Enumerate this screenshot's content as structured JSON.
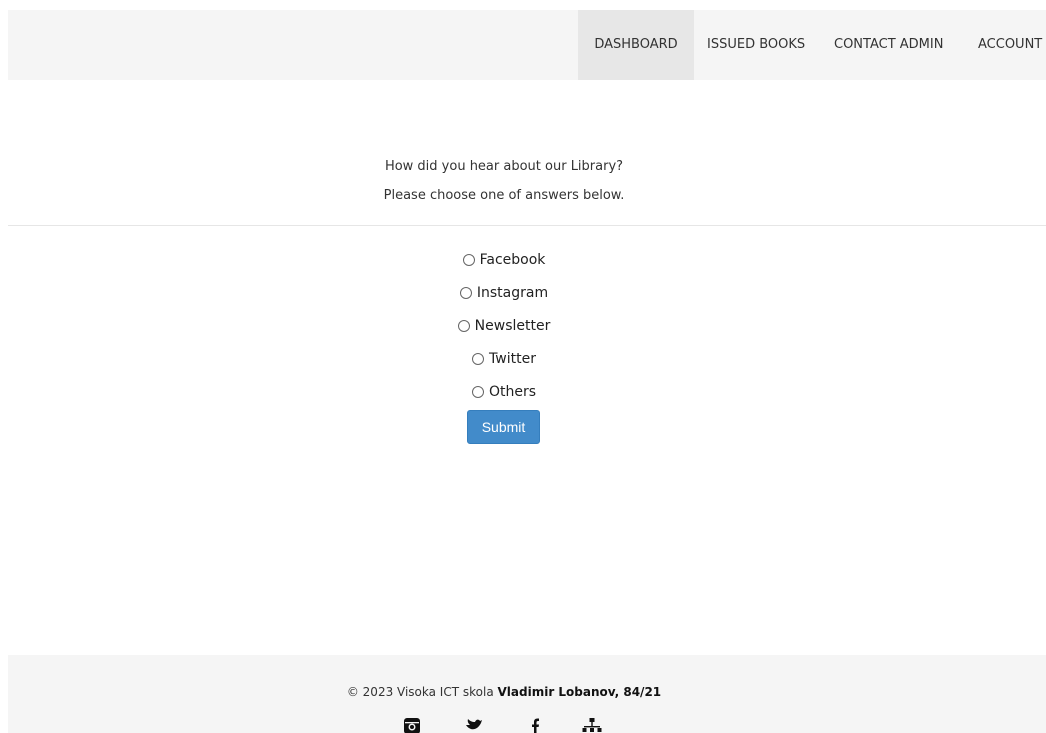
{
  "nav": {
    "items": [
      {
        "label": "DASHBOARD",
        "active": true
      },
      {
        "label": "ISSUED BOOKS"
      },
      {
        "label": "CONTACT ADMIN"
      },
      {
        "label": "ACCOUNT"
      }
    ]
  },
  "survey": {
    "question": "How did you hear about our Library?",
    "instruction": "Please choose one of answers below.",
    "options": [
      "Facebook",
      "Instagram",
      "Newsletter",
      "Twitter",
      "Others"
    ],
    "submit_label": "Submit"
  },
  "footer": {
    "copyright_prefix": "© 2023 Visoka ICT skola",
    "author": "Vladimir Lobanov, 84/21",
    "social_icons": [
      "instagram-icon",
      "twitter-icon",
      "facebook-icon",
      "sitemap-icon"
    ]
  },
  "colors": {
    "primary": "#428bca",
    "navbar_bg": "#f5f5f5",
    "nav_active_bg": "#e7e7e7"
  }
}
